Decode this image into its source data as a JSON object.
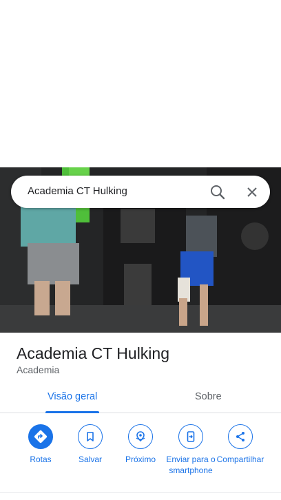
{
  "search": {
    "query": "Academia CT Hulking"
  },
  "place": {
    "name": "Academia CT Hulking",
    "category": "Academia"
  },
  "tabs": [
    {
      "label": "Visão geral",
      "active": true
    },
    {
      "label": "Sobre",
      "active": false
    }
  ],
  "actions": [
    {
      "label": "Rotas",
      "icon": "directions-icon",
      "primary": true
    },
    {
      "label": "Salvar",
      "icon": "bookmark-icon",
      "primary": false
    },
    {
      "label": "Próximo",
      "icon": "nearby-icon",
      "primary": false
    },
    {
      "label": "Enviar para o smartphone",
      "icon": "send-to-phone-icon",
      "primary": false
    },
    {
      "label": "Compartilhar",
      "icon": "share-icon",
      "primary": false
    }
  ],
  "colors": {
    "accent": "#1a73e8",
    "text_primary": "#202124",
    "text_secondary": "#5f6368"
  }
}
